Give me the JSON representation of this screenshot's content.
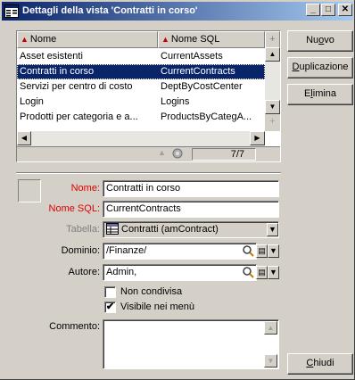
{
  "window": {
    "title": "Dettagli della vista 'Contratti in corso'",
    "minimize": "_",
    "maximize": "□",
    "close": "✕"
  },
  "list": {
    "columns": [
      "Nome",
      "Nome SQL"
    ],
    "add_column": "+",
    "rows": [
      {
        "nome": "Asset esistenti",
        "sql": "CurrentAssets",
        "selected": false
      },
      {
        "nome": "Contratti in corso",
        "sql": "CurrentContracts",
        "selected": true
      },
      {
        "nome": "Servizi per centro di costo",
        "sql": "DeptByCostCenter",
        "selected": false
      },
      {
        "nome": "Login",
        "sql": "Logins",
        "selected": false
      },
      {
        "nome": "Prodotti per categoria e a...",
        "sql": "ProductsByCategA...",
        "selected": false
      }
    ],
    "count": "7/7"
  },
  "buttons": {
    "nuovo": "Nuovo",
    "duplicazione": "Duplicazione",
    "elimina": "Elimina",
    "chiudi": "Chiudi"
  },
  "form": {
    "nome_label": "Nome:",
    "nome_value": "Contratti in corso",
    "nome_sql_label": "Nome SQL:",
    "nome_sql_value": "CurrentContracts",
    "tabella_label": "Tabella:",
    "tabella_value": "Contratti (amContract)",
    "dominio_label": "Dominio:",
    "dominio_value": "/Finanze/",
    "autore_label": "Autore:",
    "autore_value": "Admin,",
    "non_condivisa_label": "Non condivisa",
    "non_condivisa_checked": false,
    "visibile_label": "Visibile nei menù",
    "visibile_checked": true,
    "commento_label": "Commento:",
    "commento_value": ""
  },
  "colors": {
    "title_start": "#0a246a",
    "title_end": "#a6caf0",
    "selection": "#0a246a",
    "required_label": "#e00000",
    "face": "#d4d0c8"
  }
}
